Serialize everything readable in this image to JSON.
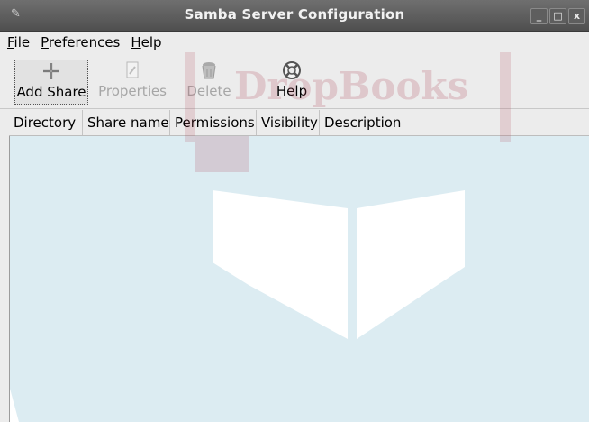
{
  "window": {
    "title": "Samba Server Configuration",
    "minimize_glyph": "_",
    "maximize_glyph": "□",
    "close_glyph": "x"
  },
  "menubar": {
    "items": [
      {
        "mnemonic": "F",
        "rest": "ile"
      },
      {
        "mnemonic": "P",
        "rest": "references"
      },
      {
        "mnemonic": "H",
        "rest": "elp"
      }
    ]
  },
  "toolbar": {
    "add_share": "Add Share",
    "properties": "Properties",
    "delete": "Delete",
    "help": "Help"
  },
  "table": {
    "columns": [
      "Directory",
      "Share name",
      "Permissions",
      "Visibility",
      "Description"
    ],
    "rows": []
  },
  "watermark": {
    "text": "DropBooks"
  },
  "colors": {
    "titlebar": "#5a5a5a",
    "content_bg": "#dcecf2",
    "watermark_red": "#b0485a"
  }
}
